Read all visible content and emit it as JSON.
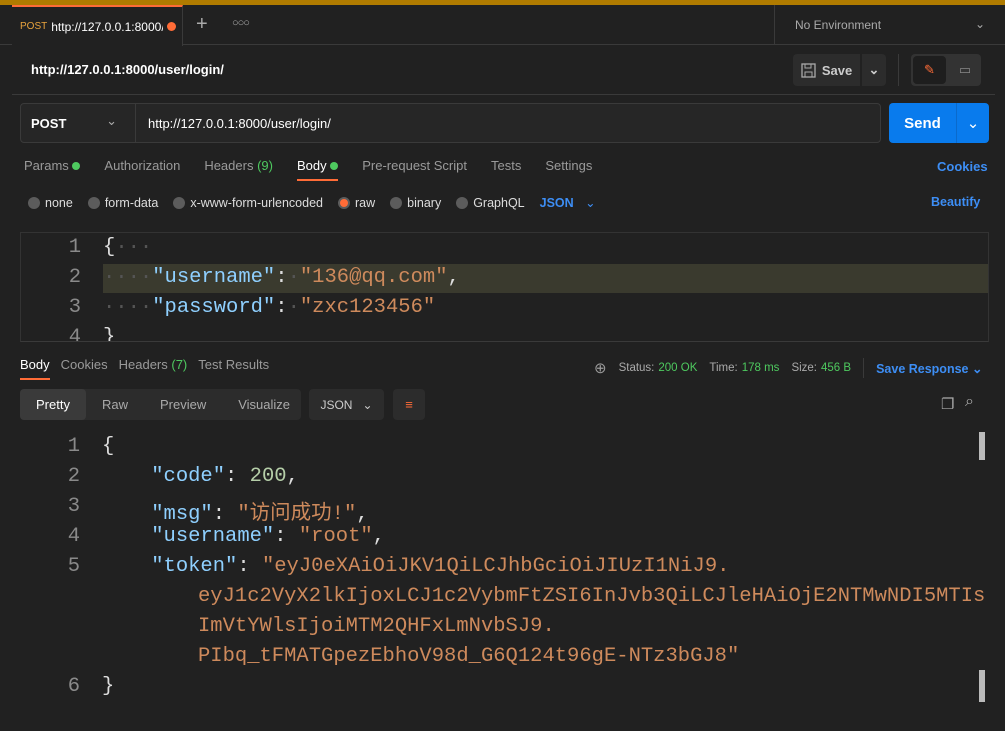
{
  "tab": {
    "method": "POST",
    "url": "http://127.0.0.1:8000/u",
    "unsaved_dot_color": "#ff6c37"
  },
  "environment": "No Environment",
  "request_title": "http://127.0.0.1:8000/user/login/",
  "toolbar": {
    "save_label": "Save"
  },
  "request": {
    "method": "POST",
    "url": "http://127.0.0.1:8000/user/login/",
    "send_label": "Send"
  },
  "request_tabs": [
    {
      "label": "Params",
      "dot": true
    },
    {
      "label": "Authorization"
    },
    {
      "label": "Headers",
      "count": "(9)"
    },
    {
      "label": "Body",
      "dot": true,
      "active": true
    },
    {
      "label": "Pre-request Script"
    },
    {
      "label": "Tests"
    },
    {
      "label": "Settings"
    }
  ],
  "cookies_label": "Cookies",
  "body_types": [
    "none",
    "form-data",
    "x-www-form-urlencoded",
    "raw",
    "binary",
    "GraphQL"
  ],
  "body_type_selected": "raw",
  "body_format": "JSON",
  "beautify_label": "Beautify",
  "request_body": {
    "line_numbers": [
      "1",
      "2",
      "3",
      "4"
    ],
    "username_key": "\"username\"",
    "username_value": "\"136@qq.com\"",
    "password_key": "\"password\"",
    "password_value": "\"zxc123456\""
  },
  "response_tabs": [
    {
      "label": "Body",
      "active": true
    },
    {
      "label": "Cookies"
    },
    {
      "label": "Headers",
      "count": "(7)"
    },
    {
      "label": "Test Results"
    }
  ],
  "status": {
    "status_label": "Status:",
    "status_value": "200 OK",
    "time_label": "Time:",
    "time_value": "178 ms",
    "size_label": "Size:",
    "size_value": "456 B",
    "save_response": "Save Response"
  },
  "view_modes": [
    "Pretty",
    "Raw",
    "Preview",
    "Visualize"
  ],
  "response_format": "JSON",
  "response_body": {
    "line_numbers": [
      "1",
      "2",
      "3",
      "4",
      "5",
      "6"
    ],
    "code_key": "\"code\"",
    "code_value": "200",
    "msg_key": "\"msg\"",
    "msg_value": "\"访问成功!\"",
    "username_key": "\"username\"",
    "username_value": "\"root\"",
    "token_key": "\"token\"",
    "token_lines": [
      "\"eyJ0eXAiOiJKV1QiLCJhbGciOiJIUzI1NiJ9.",
      "eyJ1c2VyX2lkIjoxLCJ1c2VybmFtZSI6InJvb3QiLCJleHAiOjE2NTMwNDI5MTIs",
      "ImVtYWlsIjoiMTM2QHFxLmNvbSJ9.",
      "PIbq_tFMATGpezEbhoV98d_G6Q124t96gE-NTz3bGJ8\""
    ]
  },
  "colors": {
    "accent": "#ff6c37",
    "send": "#097bed",
    "success": "#4ec95f",
    "link": "#3d8ef5"
  }
}
